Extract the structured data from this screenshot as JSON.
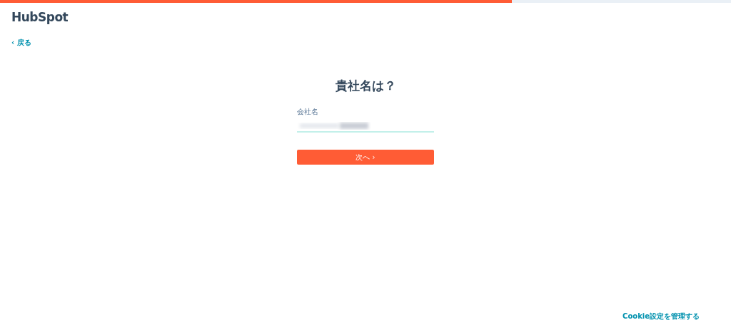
{
  "progress": {
    "level": 0.7
  },
  "logo": "HubSpot",
  "back_link": {
    "icon": "‹",
    "label": "戻る"
  },
  "heading": "貴社名は？",
  "company_field": {
    "label": "会社名"
  },
  "next_button": {
    "label": "次へ",
    "icon": "›"
  },
  "footer_link": "Cookie設定を管理する"
}
